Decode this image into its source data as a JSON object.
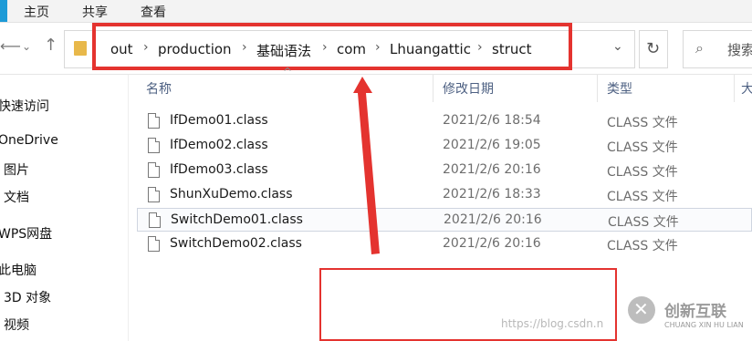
{
  "ribbon": {
    "tabs": [
      "主页",
      "共享",
      "查看"
    ]
  },
  "nav": {
    "back_icon": "back-arrow-icon",
    "forward_icon": "forward-arrow-icon",
    "recent_icon": "chevron-down-icon",
    "up_icon": "up-arrow-icon"
  },
  "address": {
    "breadcrumbs": [
      "out",
      "production",
      "基础语法",
      "com",
      "Lhuangattic",
      "struct"
    ]
  },
  "search": {
    "placeholder": "搜索"
  },
  "sidebar": {
    "items": [
      "快速访问",
      "OneDrive",
      "图片",
      "文档",
      "WPS网盘",
      "此电脑",
      "3D 对象",
      "视频"
    ]
  },
  "columns": {
    "name": "名称",
    "date": "修改日期",
    "type": "类型",
    "size": "大"
  },
  "files": [
    {
      "name": "IfDemo01.class",
      "date": "2021/2/6 18:54",
      "type": "CLASS 文件"
    },
    {
      "name": "IfDemo02.class",
      "date": "2021/2/6 19:05",
      "type": "CLASS 文件"
    },
    {
      "name": "IfDemo03.class",
      "date": "2021/2/6 20:16",
      "type": "CLASS 文件"
    },
    {
      "name": "ShunXuDemo.class",
      "date": "2021/2/6 18:33",
      "type": "CLASS 文件"
    },
    {
      "name": "SwitchDemo01.class",
      "date": "2021/2/6 20:16",
      "type": "CLASS 文件"
    },
    {
      "name": "SwitchDemo02.class",
      "date": "2021/2/6 20:16",
      "type": "CLASS 文件"
    }
  ],
  "annotation": {
    "color": "#e4332f"
  },
  "watermark": {
    "url": "https://blog.csdn.n",
    "brand_cn": "创新互联",
    "brand_en": "CHUANG XIN HU LIAN"
  }
}
